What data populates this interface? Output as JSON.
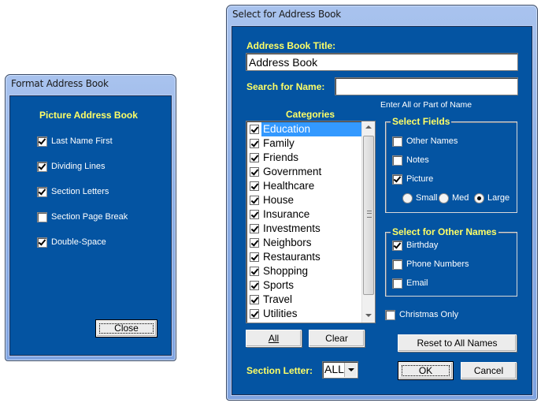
{
  "format_dialog": {
    "title": "Format Address Book",
    "heading": "Picture Address Book",
    "options": [
      {
        "label": "Last Name First",
        "checked": true
      },
      {
        "label": "Dividing Lines",
        "checked": true
      },
      {
        "label": "Section Letters",
        "checked": true
      },
      {
        "label": "Section Page Break",
        "checked": false
      },
      {
        "label": "Double-Space",
        "checked": true
      }
    ],
    "close_label": "Close"
  },
  "select_dialog": {
    "title": "Select for Address Book",
    "title_label": "Address Book Title:",
    "title_value": "Address Book",
    "search_label": "Search for Name:",
    "search_value": "",
    "search_hint": "Enter All or Part of Name",
    "categories_label": "Categories",
    "categories": [
      {
        "label": "Education",
        "checked": true,
        "selected": true
      },
      {
        "label": "Family",
        "checked": true
      },
      {
        "label": "Friends",
        "checked": true
      },
      {
        "label": "Government",
        "checked": true
      },
      {
        "label": "Healthcare",
        "checked": true
      },
      {
        "label": "House",
        "checked": true
      },
      {
        "label": "Insurance",
        "checked": true
      },
      {
        "label": "Investments",
        "checked": true
      },
      {
        "label": "Neighbors",
        "checked": true
      },
      {
        "label": "Restaurants",
        "checked": true
      },
      {
        "label": "Shopping",
        "checked": true
      },
      {
        "label": "Sports",
        "checked": true
      },
      {
        "label": "Travel",
        "checked": true
      },
      {
        "label": "Utilities",
        "checked": true
      }
    ],
    "select_fields": {
      "legend": "Select Fields",
      "options": [
        {
          "label": "Other Names",
          "checked": false
        },
        {
          "label": "Notes",
          "checked": false
        },
        {
          "label": "Picture",
          "checked": true
        }
      ],
      "picture_sizes": [
        {
          "label": "Small",
          "selected": false
        },
        {
          "label": "Med",
          "selected": false
        },
        {
          "label": "Large",
          "selected": true
        }
      ]
    },
    "other_names": {
      "legend": "Select for Other Names",
      "options": [
        {
          "label": "Birthday",
          "checked": true
        },
        {
          "label": "Phone Numbers",
          "checked": false
        },
        {
          "label": "Email",
          "checked": false
        }
      ]
    },
    "christmas_only": {
      "label": "Christmas Only",
      "checked": false
    },
    "all_label": "All",
    "clear_label": "Clear",
    "reset_label": "Reset to All Names",
    "section_letter_label": "Section Letter:",
    "section_letter_value": "ALL",
    "ok_label": "OK",
    "cancel_label": "Cancel"
  }
}
